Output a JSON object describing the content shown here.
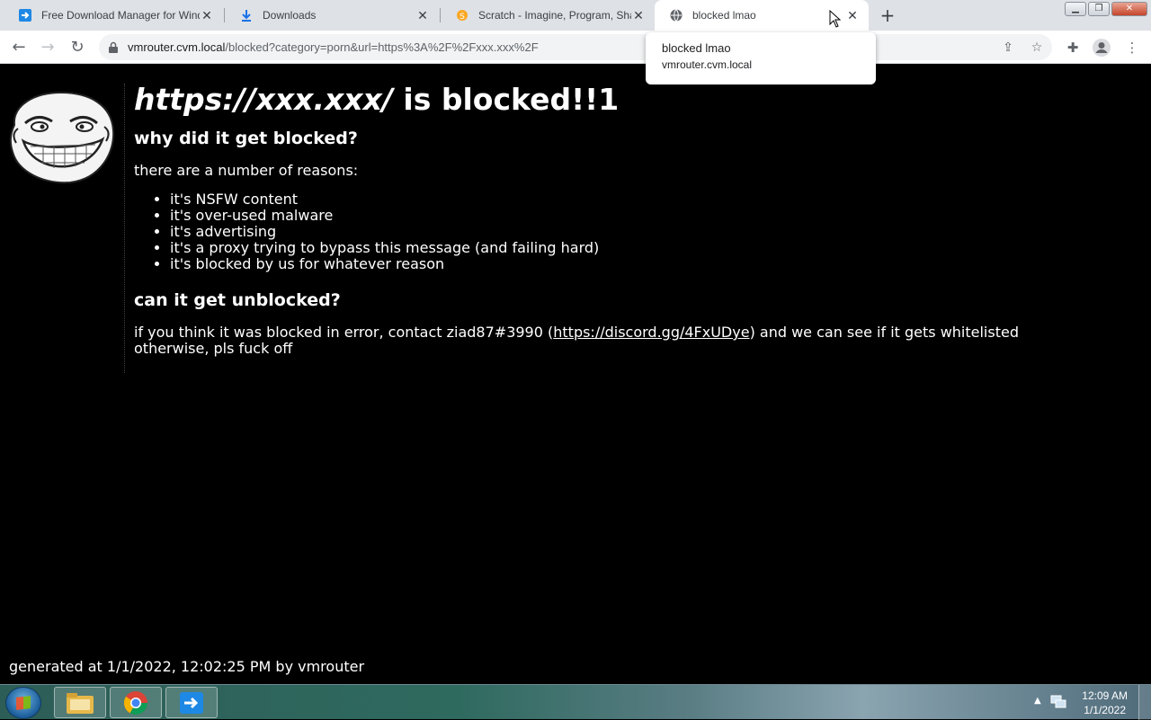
{
  "tabs": [
    {
      "title": "Free Download Manager for Windows",
      "icon": "fdm-icon"
    },
    {
      "title": "Downloads",
      "icon": "download-icon"
    },
    {
      "title": "Scratch - Imagine, Program, Share",
      "icon": "scratch-icon"
    },
    {
      "title": "blocked lmao",
      "icon": "globe-icon"
    }
  ],
  "tab_tooltip": {
    "title": "blocked lmao",
    "host": "vmrouter.cvm.local"
  },
  "address_bar": {
    "host": "vmrouter.cvm.local",
    "path": "/blocked?category=porn&url=https%3A%2F%2Fxxx.xxx%2F"
  },
  "page": {
    "blocked_url": "https://xxx.xxx/",
    "blocked_suffix": "is blocked!!1",
    "why_heading": "why did it get blocked?",
    "reasons_intro": "there are a number of reasons:",
    "reasons": [
      "it's NSFW content",
      "it's over-used malware",
      "it's advertising",
      "it's a proxy trying to bypass this message (and failing hard)",
      "it's blocked by us for whatever reason"
    ],
    "unblock_heading": "can it get unblocked?",
    "contact_prefix": "if you think it was blocked in error, contact ziad87#3990 (",
    "contact_link": "https://discord.gg/4FxUDye",
    "contact_suffix": ") and we can see if it gets whitelisted",
    "contact_line2": "otherwise, pls fuck off",
    "footer": "generated at 1/1/2022, 12:02:25 PM by vmrouter"
  },
  "taskbar": {
    "apps": [
      "file-explorer-icon",
      "chrome-icon",
      "fdm-icon"
    ],
    "clock_time": "12:09 AM",
    "clock_date": "1/1/2022"
  }
}
